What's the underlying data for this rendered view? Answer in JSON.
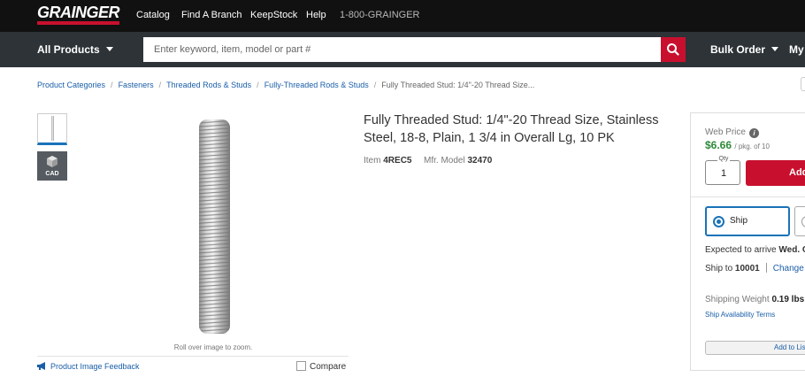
{
  "header": {
    "logo": "GRAINGER",
    "nav": [
      "Catalog",
      "Find A Branch",
      "KeepStock",
      "Help"
    ],
    "phone": "1-800-GRAINGER"
  },
  "searchbar": {
    "all_products": "All Products",
    "placeholder": "Enter keyword, item, model or part #",
    "bulk_order": "Bulk Order",
    "my_account": "My"
  },
  "breadcrumb": {
    "items": [
      "Product Categories",
      "Fasteners",
      "Threaded Rods & Studs",
      "Fully-Threaded Rods & Studs"
    ],
    "current": "Fully Threaded Stud: 1/4\"-20 Thread Size..."
  },
  "gallery": {
    "cad_label": "CAD",
    "zoom_hint": "Roll over image to zoom.",
    "feedback": "Product Image Feedback",
    "compare": "Compare"
  },
  "product": {
    "title": "Fully Threaded Stud: 1/4\"-20 Thread Size, Stainless Steel, 18-8, Plain, 1 3/4 in Overall Lg, 10 PK",
    "item_label": "Item",
    "item": "4REC5",
    "model_label": "Mfr. Model",
    "model": "32470"
  },
  "buybox": {
    "web_price_label": "Web Price",
    "price": "$6.66",
    "price_unit": "/ pkg. of 10",
    "qty_label": "Qty",
    "qty": "1",
    "add_button": "Add",
    "ship_label": "Ship",
    "arrive_text": "Expected to arrive",
    "arrive_day": "Wed. O",
    "ship_to_label": "Ship to",
    "ship_to_zip": "10001",
    "change": "Change",
    "weight_label": "Shipping Weight",
    "weight": "0.19 lbs",
    "ship_terms": "Ship Availability Terms",
    "add_to_list": "Add to Lis"
  },
  "colors": {
    "brand_red": "#c8102e",
    "price_green": "#2e8a3a",
    "link_blue": "#1a5ea8",
    "header_black": "#111111",
    "searchbar_gray": "#2d3337"
  },
  "icons": [
    "search-icon",
    "info-icon",
    "megaphone-icon",
    "cad-cube-icon",
    "chevron-down-icon"
  ]
}
